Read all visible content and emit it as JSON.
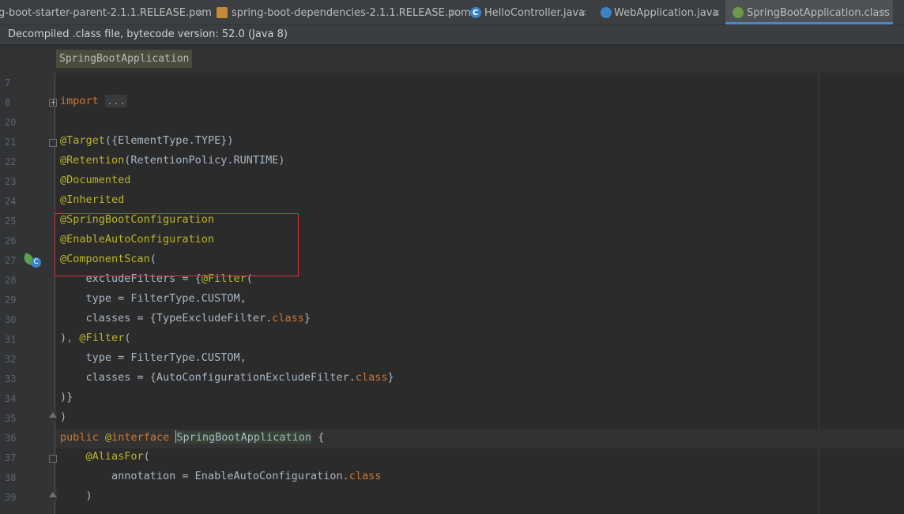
{
  "tabs": [
    {
      "label": "g-boot-starter-parent-2.1.1.RELEASE.pom",
      "icon": "maven-pom-icon",
      "active": false
    },
    {
      "label": "spring-boot-dependencies-2.1.1.RELEASE.pom",
      "icon": "maven-pom-icon",
      "active": false
    },
    {
      "label": "HelloController.java",
      "icon": "class-icon",
      "active": false
    },
    {
      "label": "WebApplication.java",
      "icon": "web-class-icon",
      "active": false
    },
    {
      "label": "SpringBootApplication.class",
      "icon": "annotation-class-icon",
      "active": true
    }
  ],
  "close_glyph": "×",
  "notice": "Decompiled .class file, bytecode version: 52.0 (Java 8)",
  "breadcrumb": "SpringBootApplication",
  "lines": [
    {
      "n": "7",
      "text": ""
    },
    {
      "n": "8",
      "text": "import ..."
    },
    {
      "n": "20",
      "text": ""
    },
    {
      "n": "21",
      "text": "@Target({ElementType.TYPE})"
    },
    {
      "n": "22",
      "text": "@Retention(RetentionPolicy.RUNTIME)"
    },
    {
      "n": "23",
      "text": "@Documented"
    },
    {
      "n": "24",
      "text": "@Inherited"
    },
    {
      "n": "25",
      "text": "@SpringBootConfiguration"
    },
    {
      "n": "26",
      "text": "@EnableAutoConfiguration"
    },
    {
      "n": "27",
      "text": "@ComponentScan("
    },
    {
      "n": "28",
      "text": "    excludeFilters = {@Filter("
    },
    {
      "n": "29",
      "text": "    type = FilterType.CUSTOM,"
    },
    {
      "n": "30",
      "text": "    classes = {TypeExcludeFilter.class}"
    },
    {
      "n": "31",
      "text": "), @Filter("
    },
    {
      "n": "32",
      "text": "    type = FilterType.CUSTOM,"
    },
    {
      "n": "33",
      "text": "    classes = {AutoConfigurationExcludeFilter.class}"
    },
    {
      "n": "34",
      "text": ")}"
    },
    {
      "n": "35",
      "text": ")"
    },
    {
      "n": "36",
      "text": "public @interface SpringBootApplication {"
    },
    {
      "n": "37",
      "text": "    @AliasFor("
    },
    {
      "n": "38",
      "text": "        annotation = EnableAutoConfiguration.class"
    },
    {
      "n": "39",
      "text": "    )"
    }
  ],
  "colors": {
    "annotation": "#bbb529",
    "keyword": "#cc7832",
    "text": "#a9b7c6",
    "highlight_box": "#d9333f"
  }
}
